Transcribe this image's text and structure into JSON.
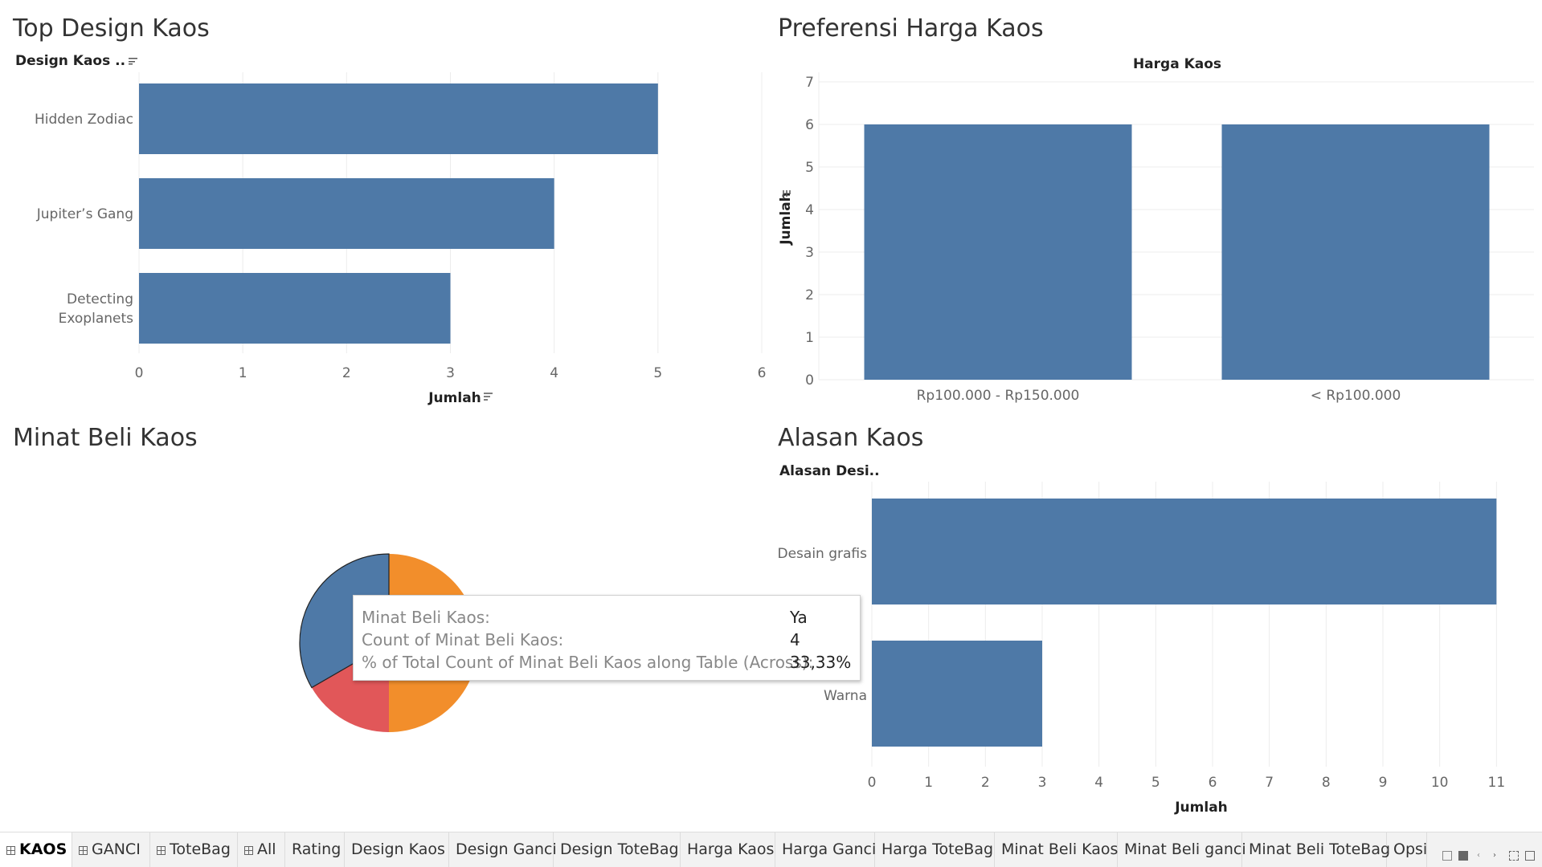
{
  "colors": {
    "bar": "#4e79a7",
    "pie_blue": "#4e79a7",
    "pie_orange": "#f28e2b",
    "pie_red": "#e15759",
    "grid": "#ececec",
    "axis_text": "#666666"
  },
  "panels": {
    "top_design": {
      "title": "Top Design Kaos",
      "field_header": "Design Kaos ..",
      "axis_label": "Jumlah"
    },
    "harga": {
      "title": "Preferensi Harga Kaos",
      "column_header": "Harga Kaos",
      "axis_label": "Jumlah"
    },
    "minat": {
      "title": "Minat Beli Kaos"
    },
    "alasan": {
      "title": "Alasan Kaos",
      "field_header": "Alasan Desi..",
      "axis_label": "Jumlah"
    }
  },
  "chart_data": [
    {
      "type": "bar",
      "orientation": "horizontal",
      "title": "Top Design Kaos",
      "categories": [
        "Hidden Zodiac",
        "Jupiter's Gang",
        "Detecting Exoplanets"
      ],
      "category_lines": [
        [
          "Hidden Zodiac"
        ],
        [
          "Jupiter’s Gang"
        ],
        [
          "Detecting",
          "Exoplanets"
        ]
      ],
      "values": [
        5,
        4,
        3
      ],
      "xlabel": "Jumlah",
      "xlim": [
        0,
        6
      ],
      "ticks": [
        0,
        1,
        2,
        3,
        4,
        5,
        6
      ]
    },
    {
      "type": "bar",
      "orientation": "vertical",
      "title": "Preferensi Harga Kaos",
      "categories": [
        "Rp100.000 - Rp150.000",
        "< Rp100.000"
      ],
      "values": [
        6,
        6
      ],
      "ylabel": "Jumlah",
      "ylim": [
        0,
        7
      ],
      "ticks": [
        0,
        1,
        2,
        3,
        4,
        5,
        6,
        7
      ]
    },
    {
      "type": "pie",
      "title": "Minat Beli Kaos",
      "slices": [
        {
          "label": "Ya",
          "value": 4,
          "percent": 33.33,
          "color": "#4e79a7"
        },
        {
          "label": "",
          "value": 6,
          "percent": 50.0,
          "color": "#f28e2b"
        },
        {
          "label": "",
          "value": 2,
          "percent": 16.67,
          "color": "#e15759"
        }
      ]
    },
    {
      "type": "bar",
      "orientation": "horizontal",
      "title": "Alasan Kaos",
      "categories": [
        "Desain grafis",
        "Warna"
      ],
      "values": [
        11,
        3
      ],
      "xlabel": "Jumlah",
      "xlim": [
        0,
        12
      ],
      "ticks": [
        0,
        1,
        2,
        3,
        4,
        5,
        6,
        7,
        8,
        9,
        10,
        11,
        12
      ]
    }
  ],
  "tooltip": {
    "rows": [
      {
        "key": "Minat Beli Kaos:",
        "value": "Ya"
      },
      {
        "key": "Count of Minat Beli Kaos:",
        "value": "4"
      },
      {
        "key": "% of Total Count of Minat Beli Kaos along Table (Across):",
        "value": "33,33%"
      }
    ]
  },
  "tabs": [
    {
      "label": "KAOS",
      "grid_icon": true,
      "active": true
    },
    {
      "label": "GANCI",
      "grid_icon": true
    },
    {
      "label": "ToteBag",
      "grid_icon": true
    },
    {
      "label": "All",
      "grid_icon": true
    },
    {
      "label": "Rating"
    },
    {
      "label": "Design  Kaos"
    },
    {
      "label": "Design Ganci"
    },
    {
      "label": "Design ToteBag"
    },
    {
      "label": "Harga Kaos"
    },
    {
      "label": "Harga Ganci"
    },
    {
      "label": "Harga ToteBag"
    },
    {
      "label": "Minat Beli Kaos"
    },
    {
      "label": "Minat Beli ganci"
    },
    {
      "label": "Minat Beli ToteBag"
    },
    {
      "label": "Opsi"
    }
  ]
}
